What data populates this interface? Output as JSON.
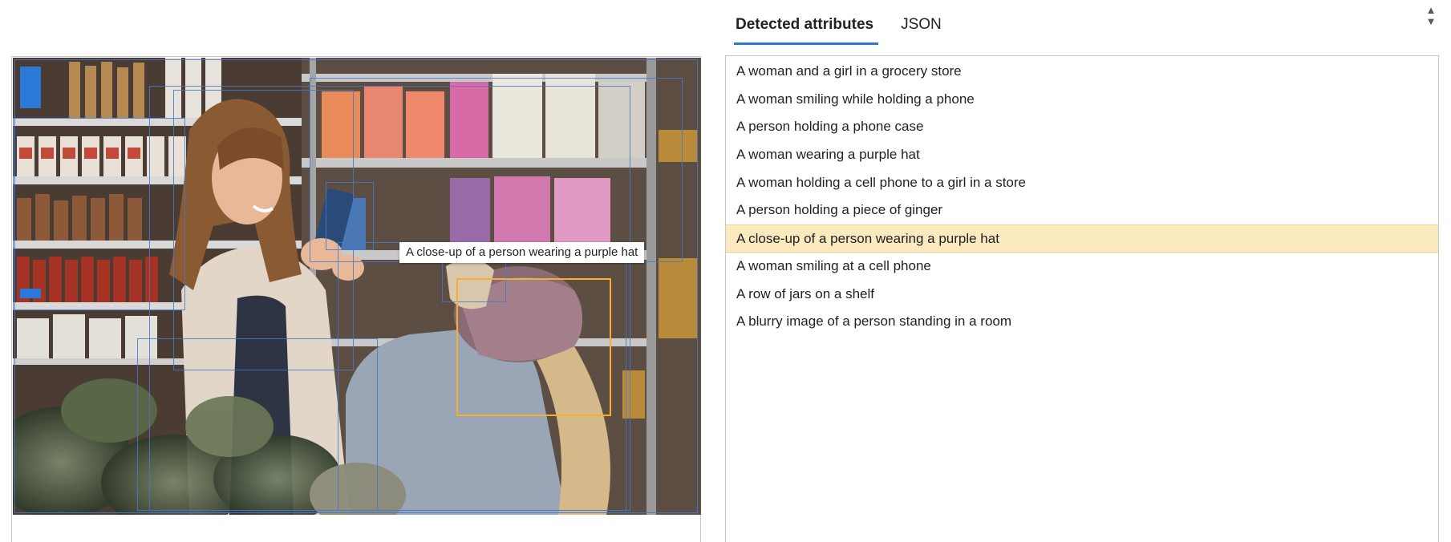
{
  "tabs": [
    {
      "label": "Detected attributes",
      "active": true
    },
    {
      "label": "JSON",
      "active": false
    }
  ],
  "scroll": {
    "up": "▲",
    "down": "▼"
  },
  "attributes": [
    "A woman and a girl in a grocery store",
    "A woman smiling while holding a phone",
    "A person holding a phone case",
    "A woman wearing a purple hat",
    "A woman holding a cell phone to a girl in a store",
    "A person holding a piece of ginger",
    "A close-up of a person wearing a purple hat",
    "A woman smiling at a cell phone",
    "A row of jars on a shelf",
    "A blurry image of a person standing in a room"
  ],
  "selected_index": 6,
  "image": {
    "tooltip": "A close-up of a person wearing a purple hat"
  },
  "colors": {
    "accent": "#2a78d8",
    "selected_box": "#f2b230",
    "highlight_row": "#fbe9bf",
    "box_outline": "#4678c8"
  }
}
